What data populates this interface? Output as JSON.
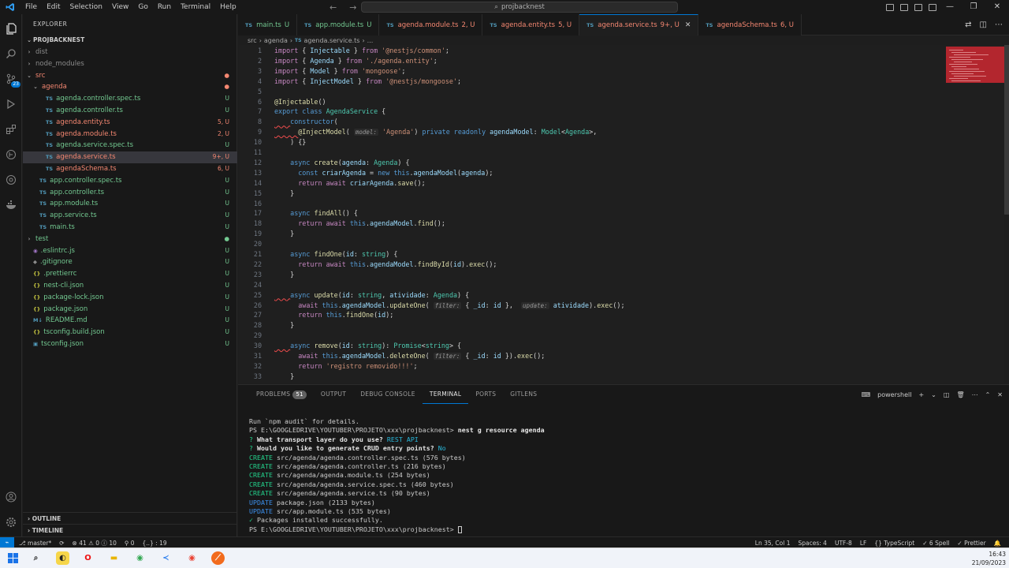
{
  "menu": [
    "File",
    "Edit",
    "Selection",
    "View",
    "Go",
    "Run",
    "Terminal",
    "Help"
  ],
  "command_center": "projbacknest",
  "explorer": {
    "title": "EXPLORER",
    "root": "PROJBACKNEST",
    "rows": [
      {
        "name": "dist",
        "kind": "folder",
        "depth": 1,
        "status": "",
        "color": "c-dim"
      },
      {
        "name": "node_modules",
        "kind": "folder",
        "depth": 1,
        "status": "",
        "color": "c-dim"
      },
      {
        "name": "src",
        "kind": "folder-open",
        "depth": 1,
        "status": "●",
        "color": "c-err"
      },
      {
        "name": "agenda",
        "kind": "folder-open",
        "depth": 2,
        "status": "●",
        "color": "c-err"
      },
      {
        "name": "agenda.controller.spec.ts",
        "kind": "ts",
        "depth": 3,
        "status": "U",
        "color": "c-untr"
      },
      {
        "name": "agenda.controller.ts",
        "kind": "ts",
        "depth": 3,
        "status": "U",
        "color": "c-untr"
      },
      {
        "name": "agenda.entity.ts",
        "kind": "ts",
        "depth": 3,
        "status": "5, U",
        "color": "c-err"
      },
      {
        "name": "agenda.module.ts",
        "kind": "ts",
        "depth": 3,
        "status": "2, U",
        "color": "c-err"
      },
      {
        "name": "agenda.service.spec.ts",
        "kind": "ts",
        "depth": 3,
        "status": "U",
        "color": "c-untr"
      },
      {
        "name": "agenda.service.ts",
        "kind": "ts",
        "depth": 3,
        "status": "9+, U",
        "color": "c-err",
        "selected": true
      },
      {
        "name": "agendaSchema.ts",
        "kind": "ts",
        "depth": 3,
        "status": "6, U",
        "color": "c-err"
      },
      {
        "name": "app.controller.spec.ts",
        "kind": "ts",
        "depth": 2,
        "status": "U",
        "color": "c-untr"
      },
      {
        "name": "app.controller.ts",
        "kind": "ts",
        "depth": 2,
        "status": "U",
        "color": "c-untr"
      },
      {
        "name": "app.module.ts",
        "kind": "ts",
        "depth": 2,
        "status": "U",
        "color": "c-untr"
      },
      {
        "name": "app.service.ts",
        "kind": "ts",
        "depth": 2,
        "status": "U",
        "color": "c-untr"
      },
      {
        "name": "main.ts",
        "kind": "ts",
        "depth": 2,
        "status": "U",
        "color": "c-untr"
      },
      {
        "name": "test",
        "kind": "folder",
        "depth": 1,
        "status": "●",
        "color": "c-untr"
      },
      {
        "name": ".eslintrc.js",
        "kind": "eslint",
        "depth": 1,
        "status": "U",
        "color": "c-untr"
      },
      {
        "name": ".gitignore",
        "kind": "git",
        "depth": 1,
        "status": "U",
        "color": "c-untr"
      },
      {
        "name": ".prettierrc",
        "kind": "json",
        "depth": 1,
        "status": "U",
        "color": "c-untr"
      },
      {
        "name": "nest-cli.json",
        "kind": "json",
        "depth": 1,
        "status": "U",
        "color": "c-untr"
      },
      {
        "name": "package-lock.json",
        "kind": "json",
        "depth": 1,
        "status": "U",
        "color": "c-untr"
      },
      {
        "name": "package.json",
        "kind": "json",
        "depth": 1,
        "status": "U",
        "color": "c-untr"
      },
      {
        "name": "README.md",
        "kind": "md",
        "depth": 1,
        "status": "U",
        "color": "c-untr"
      },
      {
        "name": "tsconfig.build.json",
        "kind": "json",
        "depth": 1,
        "status": "U",
        "color": "c-untr"
      },
      {
        "name": "tsconfig.json",
        "kind": "tsconfig",
        "depth": 1,
        "status": "U",
        "color": "c-untr"
      }
    ],
    "outline": "OUTLINE",
    "timeline": "TIMELINE"
  },
  "tabs": [
    {
      "label": "main.ts",
      "status": "U",
      "color": "c-untr"
    },
    {
      "label": "app.module.ts",
      "status": "U",
      "color": "c-untr"
    },
    {
      "label": "agenda.module.ts",
      "status": "2, U",
      "color": "c-err"
    },
    {
      "label": "agenda.entity.ts",
      "status": "5, U",
      "color": "c-err"
    },
    {
      "label": "agenda.service.ts",
      "status": "9+, U",
      "color": "c-err",
      "active": true
    },
    {
      "label": "agendaSchema.ts",
      "status": "6, U",
      "color": "c-err"
    }
  ],
  "breadcrumb": [
    "src",
    "agenda",
    "agenda.service.ts",
    "..."
  ],
  "code_lines": [
    [
      [
        "kw2",
        "import"
      ],
      [
        "pun",
        " { "
      ],
      [
        "var",
        "Injectable"
      ],
      [
        "pun",
        " } "
      ],
      [
        "kw2",
        "from"
      ],
      [
        "str",
        " '@nestjs/common'"
      ],
      [
        "pun",
        ";"
      ]
    ],
    [
      [
        "kw2",
        "import"
      ],
      [
        "pun",
        " { "
      ],
      [
        "var",
        "Agenda"
      ],
      [
        "pun",
        " } "
      ],
      [
        "kw2",
        "from"
      ],
      [
        "str",
        " './agenda.entity'"
      ],
      [
        "pun",
        ";"
      ]
    ],
    [
      [
        "kw2",
        "import"
      ],
      [
        "pun",
        " { "
      ],
      [
        "var",
        "Model"
      ],
      [
        "pun",
        " } "
      ],
      [
        "kw2",
        "from"
      ],
      [
        "str",
        " 'mongoose'"
      ],
      [
        "pun",
        ";"
      ]
    ],
    [
      [
        "kw2",
        "import"
      ],
      [
        "pun",
        " { "
      ],
      [
        "var",
        "InjectModel"
      ],
      [
        "pun",
        " } "
      ],
      [
        "kw2",
        "from"
      ],
      [
        "str",
        " '@nestjs/mongoose'"
      ],
      [
        "pun",
        ";"
      ]
    ],
    [],
    [
      [
        "dec",
        "@Injectable"
      ],
      [
        "pun",
        "()"
      ]
    ],
    [
      [
        "kw",
        "export"
      ],
      [
        "kw",
        " class "
      ],
      [
        "cls",
        "AgendaService"
      ],
      [
        "pun",
        " {"
      ]
    ],
    [
      [
        "pun",
        "    "
      ],
      [
        "kw",
        "constructor"
      ],
      [
        "pun",
        "("
      ]
    ],
    [
      [
        "pun",
        "      "
      ],
      [
        "dec",
        "@InjectModel"
      ],
      [
        "pun",
        "( "
      ],
      [
        "hint",
        "model:"
      ],
      [
        "str",
        " 'Agenda'"
      ],
      [
        "pun",
        ") "
      ],
      [
        "kw",
        "private readonly "
      ],
      [
        "var",
        "agendaModel"
      ],
      [
        "pun",
        ": "
      ],
      [
        "cls",
        "Model"
      ],
      [
        "pun",
        "<"
      ],
      [
        "cls",
        "Agenda"
      ],
      [
        "pun",
        ">,"
      ]
    ],
    [
      [
        "pun",
        "    ) {}"
      ]
    ],
    [],
    [
      [
        "pun",
        "    "
      ],
      [
        "kw",
        "async "
      ],
      [
        "fn",
        "create"
      ],
      [
        "pun",
        "("
      ],
      [
        "var",
        "agenda"
      ],
      [
        "pun",
        ": "
      ],
      [
        "cls",
        "Agenda"
      ],
      [
        "pun",
        ") {"
      ]
    ],
    [
      [
        "pun",
        "      "
      ],
      [
        "kw",
        "const "
      ],
      [
        "var",
        "criarAgenda"
      ],
      [
        "pun",
        " = "
      ],
      [
        "kw",
        "new "
      ],
      [
        "kw",
        "this"
      ],
      [
        "pun",
        "."
      ],
      [
        "var",
        "agendaModel"
      ],
      [
        "pun",
        "("
      ],
      [
        "var",
        "agenda"
      ],
      [
        "pun",
        ");"
      ]
    ],
    [
      [
        "pun",
        "      "
      ],
      [
        "kw2",
        "return await "
      ],
      [
        "var",
        "criarAgenda"
      ],
      [
        "pun",
        "."
      ],
      [
        "fn",
        "save"
      ],
      [
        "pun",
        "();"
      ]
    ],
    [
      [
        "pun",
        "    }"
      ]
    ],
    [],
    [
      [
        "pun",
        "    "
      ],
      [
        "kw",
        "async "
      ],
      [
        "fn",
        "findAll"
      ],
      [
        "pun",
        "() {"
      ]
    ],
    [
      [
        "pun",
        "      "
      ],
      [
        "kw2",
        "return await "
      ],
      [
        "kw",
        "this"
      ],
      [
        "pun",
        "."
      ],
      [
        "var",
        "agendaModel"
      ],
      [
        "pun",
        "."
      ],
      [
        "fn",
        "find"
      ],
      [
        "pun",
        "();"
      ]
    ],
    [
      [
        "pun",
        "    }"
      ]
    ],
    [],
    [
      [
        "pun",
        "    "
      ],
      [
        "kw",
        "async "
      ],
      [
        "fn",
        "findOne"
      ],
      [
        "pun",
        "("
      ],
      [
        "var",
        "id"
      ],
      [
        "pun",
        ": "
      ],
      [
        "cls",
        "string"
      ],
      [
        "pun",
        ") {"
      ]
    ],
    [
      [
        "pun",
        "      "
      ],
      [
        "kw2",
        "return await "
      ],
      [
        "kw",
        "this"
      ],
      [
        "pun",
        "."
      ],
      [
        "var",
        "agendaModel"
      ],
      [
        "pun",
        "."
      ],
      [
        "fn",
        "findById"
      ],
      [
        "pun",
        "("
      ],
      [
        "var",
        "id"
      ],
      [
        "pun",
        ")."
      ],
      [
        "fn",
        "exec"
      ],
      [
        "pun",
        "();"
      ]
    ],
    [
      [
        "pun",
        "    }"
      ]
    ],
    [],
    [
      [
        "pun",
        "    "
      ],
      [
        "kw",
        "async "
      ],
      [
        "fn",
        "update"
      ],
      [
        "pun",
        "("
      ],
      [
        "var",
        "id"
      ],
      [
        "pun",
        ": "
      ],
      [
        "cls",
        "string"
      ],
      [
        "pun",
        ", "
      ],
      [
        "var",
        "atividade"
      ],
      [
        "pun",
        ": "
      ],
      [
        "cls",
        "Agenda"
      ],
      [
        "pun",
        ") {"
      ]
    ],
    [
      [
        "pun",
        "      "
      ],
      [
        "kw2",
        "await "
      ],
      [
        "kw",
        "this"
      ],
      [
        "pun",
        "."
      ],
      [
        "var",
        "agendaModel"
      ],
      [
        "pun",
        "."
      ],
      [
        "fn",
        "updateOne"
      ],
      [
        "pun",
        "( "
      ],
      [
        "hint",
        "filter:"
      ],
      [
        "pun",
        " { "
      ],
      [
        "var",
        "_id"
      ],
      [
        "pun",
        ": "
      ],
      [
        "var",
        "id"
      ],
      [
        "pun",
        " },  "
      ],
      [
        "hint",
        "update:"
      ],
      [
        "pun",
        " "
      ],
      [
        "var",
        "atividade"
      ],
      [
        "pun",
        ")."
      ],
      [
        "fn",
        "exec"
      ],
      [
        "pun",
        "();"
      ]
    ],
    [
      [
        "pun",
        "      "
      ],
      [
        "kw2",
        "return "
      ],
      [
        "kw",
        "this"
      ],
      [
        "pun",
        "."
      ],
      [
        "fn",
        "findOne"
      ],
      [
        "pun",
        "("
      ],
      [
        "var",
        "id"
      ],
      [
        "pun",
        ");"
      ]
    ],
    [
      [
        "pun",
        "    }"
      ]
    ],
    [],
    [
      [
        "pun",
        "    "
      ],
      [
        "kw",
        "async "
      ],
      [
        "fn",
        "remove"
      ],
      [
        "pun",
        "("
      ],
      [
        "var",
        "id"
      ],
      [
        "pun",
        ": "
      ],
      [
        "cls",
        "string"
      ],
      [
        "pun",
        "): "
      ],
      [
        "cls",
        "Promise"
      ],
      [
        "pun",
        "<"
      ],
      [
        "cls",
        "string"
      ],
      [
        "pun",
        "> {"
      ]
    ],
    [
      [
        "pun",
        "      "
      ],
      [
        "kw2",
        "await "
      ],
      [
        "kw",
        "this"
      ],
      [
        "pun",
        "."
      ],
      [
        "var",
        "agendaModel"
      ],
      [
        "pun",
        "."
      ],
      [
        "fn",
        "deleteOne"
      ],
      [
        "pun",
        "( "
      ],
      [
        "hint",
        "filter:"
      ],
      [
        "pun",
        " { "
      ],
      [
        "var",
        "_id"
      ],
      [
        "pun",
        ": "
      ],
      [
        "var",
        "id"
      ],
      [
        "pun",
        " })."
      ],
      [
        "fn",
        "exec"
      ],
      [
        "pun",
        "();"
      ]
    ],
    [
      [
        "pun",
        "      "
      ],
      [
        "kw2",
        "return "
      ],
      [
        "str",
        "'registro removido!!!'"
      ],
      [
        "pun",
        ";"
      ]
    ],
    [
      [
        "pun",
        "    }"
      ]
    ],
    [
      [
        "pun",
        "  }"
      ]
    ]
  ],
  "panel": {
    "tabs": [
      "PROBLEMS",
      "OUTPUT",
      "DEBUG CONSOLE",
      "TERMINAL",
      "PORTS",
      "GITLENS"
    ],
    "problems_count": "51",
    "shell": "powershell",
    "terminal_lines": [
      [
        [
          "",
          "Run `npm audit` for details."
        ]
      ],
      [
        [
          "",
          "PS E:\\GOOGLEDRIVE\\YOUTUBER\\PROJETO\\xxx\\projbacknest> "
        ],
        [
          "t-bold",
          "nest g resource agenda"
        ]
      ],
      [
        [
          "t-green",
          "? "
        ],
        [
          "t-bold",
          "What transport layer do you use? "
        ],
        [
          "t-cyan",
          "REST API"
        ]
      ],
      [
        [
          "t-green",
          "? "
        ],
        [
          "t-bold",
          "Would you like to generate CRUD entry points? "
        ],
        [
          "t-cyan",
          "No"
        ]
      ],
      [
        [
          "t-green",
          "CREATE"
        ],
        [
          "",
          " src/agenda/agenda.controller.spec.ts (576 bytes)"
        ]
      ],
      [
        [
          "t-green",
          "CREATE"
        ],
        [
          "",
          " src/agenda/agenda.controller.ts (216 bytes)"
        ]
      ],
      [
        [
          "t-green",
          "CREATE"
        ],
        [
          "",
          " src/agenda/agenda.module.ts (254 bytes)"
        ]
      ],
      [
        [
          "t-green",
          "CREATE"
        ],
        [
          "",
          " src/agenda/agenda.service.spec.ts (460 bytes)"
        ]
      ],
      [
        [
          "t-green",
          "CREATE"
        ],
        [
          "",
          " src/agenda/agenda.service.ts (90 bytes)"
        ]
      ],
      [
        [
          "t-blue",
          "UPDATE"
        ],
        [
          "",
          " package.json (2133 bytes)"
        ]
      ],
      [
        [
          "t-blue",
          "UPDATE"
        ],
        [
          "",
          " src/app.module.ts (535 bytes)"
        ]
      ],
      [
        [
          "t-green",
          "✓ "
        ],
        [
          "",
          "Packages installed successfully."
        ]
      ],
      [
        [
          "",
          "PS E:\\GOOGLEDRIVE\\YOUTUBER\\PROJETO\\xxx\\projbacknest> "
        ]
      ]
    ]
  },
  "status": {
    "branch": "master*",
    "errors": "41",
    "warnings": "0",
    "info": "10",
    "ports": "0",
    "braces": "{..} : 19",
    "cursor": "Ln 35, Col 1",
    "spaces": "Spaces: 4",
    "encoding": "UTF-8",
    "eol": "LF",
    "language": "TypeScript",
    "spell": "6 Spell",
    "prettier": "Prettier"
  },
  "clock": {
    "time": "16:43",
    "date": "21/09/2023"
  },
  "colors": {
    "accent": "#0078d4",
    "error": "#f48771",
    "untracked": "#73c991"
  }
}
